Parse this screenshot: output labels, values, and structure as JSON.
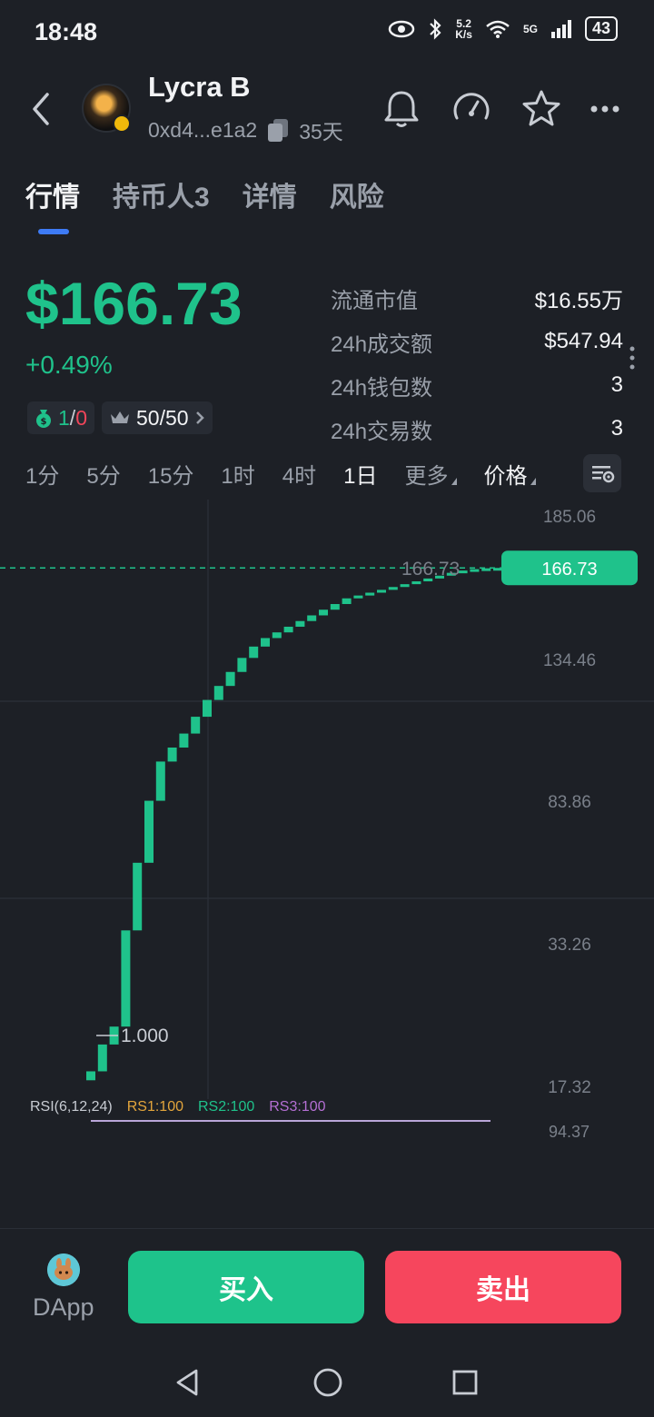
{
  "status_bar": {
    "time": "18:48",
    "net_speed_value": "5.2",
    "net_speed_unit": "K/s",
    "network": "5G",
    "battery": "43"
  },
  "header": {
    "token_name": "Lycra B",
    "address": "0xd4...e1a2",
    "age": "35天"
  },
  "tabs": [
    {
      "label": "行情",
      "active": true
    },
    {
      "label": "持币人3",
      "active": false
    },
    {
      "label": "详情",
      "active": false
    },
    {
      "label": "风险",
      "active": false
    }
  ],
  "price": {
    "value": "$166.73",
    "change": "+0.49%",
    "buy_sell_green": "1",
    "buy_sell_sep": "/",
    "buy_sell_red": "0",
    "top_holders": "50/50"
  },
  "stats": [
    {
      "label": "流通市值",
      "value": "$16.55万"
    },
    {
      "label": "24h成交额",
      "value": "$547.94"
    },
    {
      "label": "24h钱包数",
      "value": "3"
    },
    {
      "label": "24h交易数",
      "value": "3"
    }
  ],
  "timeframes": [
    {
      "label": "1分",
      "active": false
    },
    {
      "label": "5分",
      "active": false
    },
    {
      "label": "15分",
      "active": false
    },
    {
      "label": "1时",
      "active": false
    },
    {
      "label": "4时",
      "active": false
    },
    {
      "label": "1日",
      "active": true
    }
  ],
  "more_label": "更多",
  "price_label": "价格",
  "chart_data": {
    "type": "candlestick",
    "y_ticks": [
      "185.06",
      "134.46",
      "83.86",
      "33.26",
      "17.32"
    ],
    "current_price": 166.73,
    "current_price_label": "166.73",
    "min_label": "1.000",
    "ylim": [
      17.32,
      185.06
    ],
    "candles": [
      {
        "o": 18,
        "c": 19
      },
      {
        "o": 19,
        "c": 22
      },
      {
        "o": 22,
        "c": 24
      },
      {
        "o": 24,
        "c": 38
      },
      {
        "o": 38,
        "c": 62
      },
      {
        "o": 62,
        "c": 84
      },
      {
        "o": 84,
        "c": 98
      },
      {
        "o": 98,
        "c": 103
      },
      {
        "o": 103,
        "c": 108
      },
      {
        "o": 108,
        "c": 114
      },
      {
        "o": 114,
        "c": 120
      },
      {
        "o": 120,
        "c": 125
      },
      {
        "o": 125,
        "c": 130
      },
      {
        "o": 130,
        "c": 135
      },
      {
        "o": 135,
        "c": 139
      },
      {
        "o": 139,
        "c": 142
      },
      {
        "o": 142,
        "c": 144
      },
      {
        "o": 144,
        "c": 146
      },
      {
        "o": 146,
        "c": 148
      },
      {
        "o": 148,
        "c": 150
      },
      {
        "o": 150,
        "c": 152
      },
      {
        "o": 152,
        "c": 154
      },
      {
        "o": 154,
        "c": 156
      },
      {
        "o": 156,
        "c": 157
      },
      {
        "o": 157,
        "c": 158
      },
      {
        "o": 158,
        "c": 159
      },
      {
        "o": 159,
        "c": 160
      },
      {
        "o": 160,
        "c": 161
      },
      {
        "o": 161,
        "c": 162
      },
      {
        "o": 162,
        "c": 163
      },
      {
        "o": 163,
        "c": 164
      },
      {
        "o": 164,
        "c": 165
      },
      {
        "o": 165,
        "c": 165.8
      },
      {
        "o": 165.8,
        "c": 166.3
      },
      {
        "o": 166.3,
        "c": 166.6
      },
      {
        "o": 166.6,
        "c": 166.73
      }
    ]
  },
  "rsi": {
    "label": "RSI(6,12,24)",
    "rs1": "RS1:100",
    "rs2": "RS2:100",
    "rs3": "RS3:100",
    "top_value": "94.37"
  },
  "bottom": {
    "dapp_label": "DApp",
    "buy_label": "买入",
    "sell_label": "卖出"
  },
  "colors": {
    "up": "#1fc28b",
    "down": "#f6465d",
    "accent": "#3e7bf5",
    "background": "#1d2026"
  }
}
